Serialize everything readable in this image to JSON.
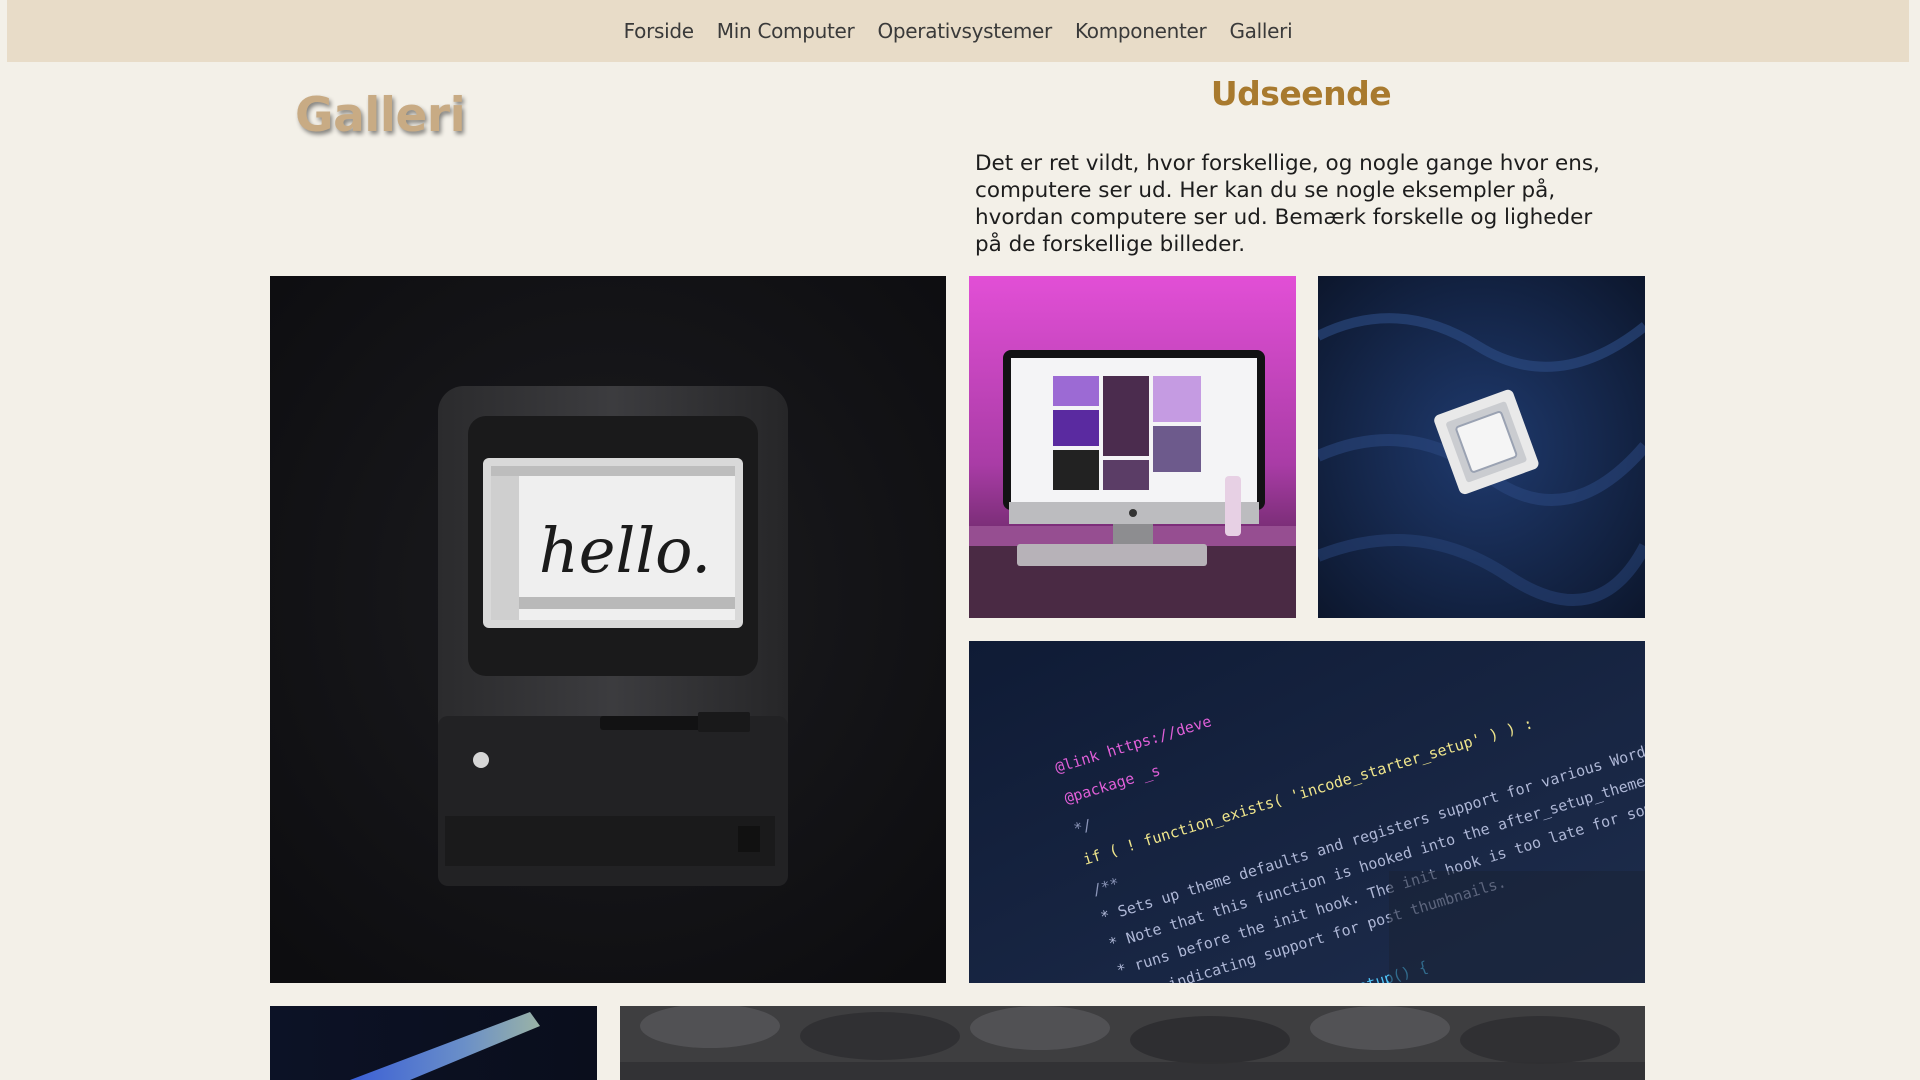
{
  "nav": {
    "items": [
      "Forside",
      "Min Computer",
      "Operativsystemer",
      "Komponenter",
      "Galleri"
    ]
  },
  "page": {
    "title": "Galleri"
  },
  "section": {
    "title": "Udseende",
    "text": "Det er ret vildt, hvor forskellige, og nogle gange hvor ens, computere ser ud. Her kan du se nogle eksempler på, hvordan computere ser ud. Bemærk forskelle og ligheder på de forskellige billeder."
  },
  "gallery": {
    "vintage_screen_text": "hello.",
    "code_lines": [
      "@link https://deve",
      "@package _s",
      "*/",
      "if ( ! function_exists( 'incode_starter_setup' ) ) :",
      "/**",
      " * Sets up theme defaults and registers support for various WordPress features.",
      " * Note that this function is hooked into the after_setup_theme hook, which",
      " * runs before the init hook. The init hook is too late for some features, such",
      " * as indicating support for post thumbnails.",
      " */",
      "function incode_starter_setup() {"
    ]
  },
  "colors": {
    "background": "#f3f0e8",
    "navbar": "#e8dcc8",
    "title": "#c8ab84",
    "accent": "#a87a2e"
  }
}
